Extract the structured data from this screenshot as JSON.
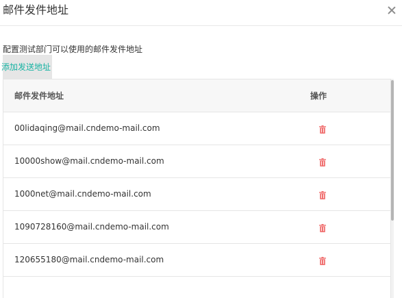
{
  "dialog": {
    "title": "邮件发件地址",
    "close_icon": "close-icon"
  },
  "description": "配置测试部门可以使用的邮件发件地址",
  "add_link_label": "添加发送地址",
  "table": {
    "headers": {
      "email": "邮件发件地址",
      "operation": "操作"
    },
    "rows": [
      {
        "email": "00lidaqing@mail.cndemo-mail.com"
      },
      {
        "email": "10000show@mail.cndemo-mail.com"
      },
      {
        "email": "1000net@mail.cndemo-mail.com"
      },
      {
        "email": "1090728160@mail.cndemo-mail.com"
      },
      {
        "email": "120655180@mail.cndemo-mail.com"
      }
    ],
    "row_action_icon": "trash-icon"
  },
  "colors": {
    "accent_link": "#17b3a3",
    "delete_icon": "#f07070"
  }
}
